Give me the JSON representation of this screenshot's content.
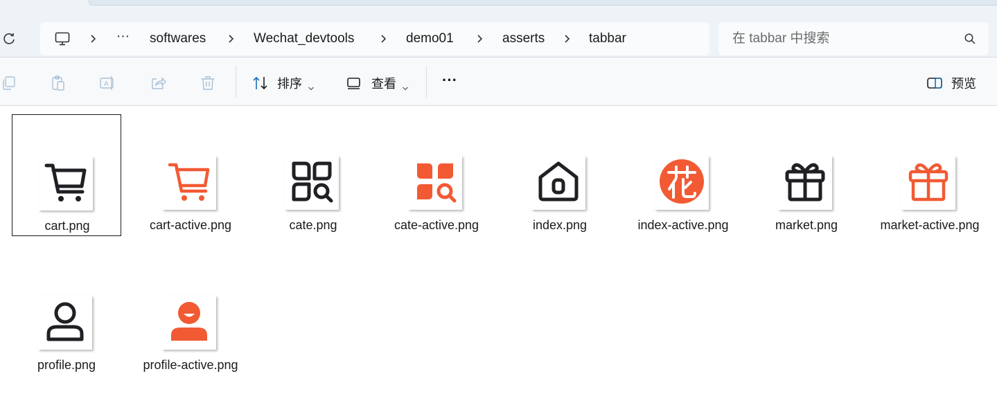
{
  "breadcrumb": {
    "more": "···",
    "segments": [
      "softwares",
      "Wechat_devtools",
      "demo01",
      "asserts",
      "tabbar"
    ]
  },
  "search": {
    "placeholder": "在 tabbar 中搜索"
  },
  "toolbar": {
    "sort_label": "排序",
    "view_label": "查看",
    "more_label": "···",
    "preview_label": "预览"
  },
  "colors": {
    "accent": "#f25a33",
    "icon_dark": "#1f1f24",
    "address_bg": "#eef3f8"
  },
  "files": [
    {
      "name": "cart.png",
      "icon": "cart-icon",
      "active": false,
      "selected": true
    },
    {
      "name": "cart-active.png",
      "icon": "cart-icon",
      "active": true,
      "selected": false
    },
    {
      "name": "cate.png",
      "icon": "category-icon",
      "active": false,
      "selected": false
    },
    {
      "name": "cate-active.png",
      "icon": "category-icon",
      "active": true,
      "selected": false
    },
    {
      "name": "index.png",
      "icon": "home-icon",
      "active": false,
      "selected": false
    },
    {
      "name": "index-active.png",
      "icon": "flower-badge-icon",
      "active": true,
      "selected": false
    },
    {
      "name": "market.png",
      "icon": "gift-icon",
      "active": false,
      "selected": false
    },
    {
      "name": "market-active.png",
      "icon": "gift-icon",
      "active": true,
      "selected": false
    },
    {
      "name": "profile.png",
      "icon": "user-icon",
      "active": false,
      "selected": false
    },
    {
      "name": "profile-active.png",
      "icon": "user-icon",
      "active": true,
      "selected": false
    }
  ]
}
